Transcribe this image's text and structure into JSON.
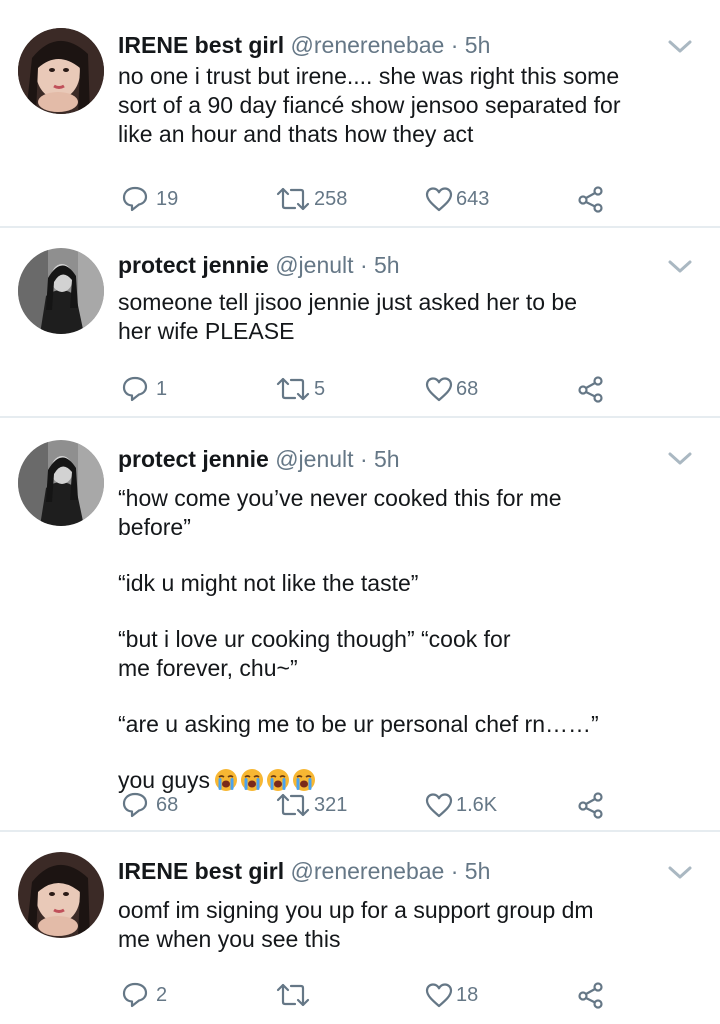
{
  "tweets": [
    {
      "name": "IRENE best girl",
      "handle": "@renerenebae",
      "separator": "·",
      "time": "5h",
      "avatar": "irene-avatar",
      "body": [
        "no one i trust but irene.... she was right this some sort of a 90 day fiancé show jensoo separated for like an hour and thats how they act"
      ],
      "replies": "19",
      "retweets": "258",
      "likes": "643"
    },
    {
      "name": "protect jennie",
      "handle": "@jenult",
      "separator": "·",
      "time": "5h",
      "avatar": "jennie-avatar",
      "body": [
        "someone tell jisoo jennie just asked her to be her wife PLEASE"
      ],
      "replies": "1",
      "retweets": "5",
      "likes": "68"
    },
    {
      "name": "protect jennie",
      "handle": "@jenult",
      "separator": "·",
      "time": "5h",
      "avatar": "jennie-avatar",
      "body": [
        "“how come you’ve never cooked this for me before”",
        "“idk u might not like the taste”",
        "“but i love ur cooking though” “cook for me forever, chu~”",
        "“are u asking me to be ur personal chef rn……”",
        "you guys"
      ],
      "emoji": [
        "loudly-crying-face",
        "loudly-crying-face",
        "loudly-crying-face",
        "loudly-crying-face"
      ],
      "replies": "68",
      "retweets": "321",
      "likes": "1.6K"
    },
    {
      "name": "IRENE best girl",
      "handle": "@renerenebae",
      "separator": "·",
      "time": "5h",
      "avatar": "irene-avatar",
      "body": [
        "oomf im signing you up for a support group dm me when you see this"
      ],
      "replies": "2",
      "retweets": "",
      "likes": "18"
    }
  ],
  "colors": {
    "text": "#14171a",
    "secondary": "#657786",
    "divider": "#e6ecf0",
    "chevron": "#aab8c2"
  },
  "icons": [
    "reply-icon",
    "retweet-icon",
    "like-icon",
    "share-icon",
    "chevron-down-icon"
  ]
}
